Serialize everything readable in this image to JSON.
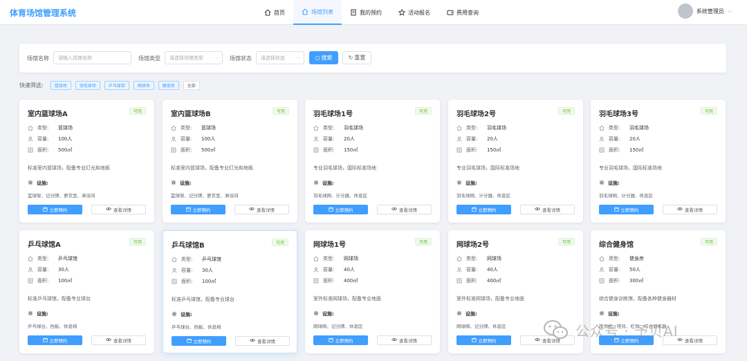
{
  "app": {
    "title": "体育场馆管理系统"
  },
  "nav": [
    {
      "label": "首页",
      "icon": "home-icon",
      "active": false
    },
    {
      "label": "场馆列表",
      "icon": "venue-icon",
      "active": true
    },
    {
      "label": "我的预约",
      "icon": "document-icon",
      "active": false
    },
    {
      "label": "活动报名",
      "icon": "star-icon",
      "active": false
    },
    {
      "label": "费用查询",
      "icon": "wallet-icon",
      "active": false
    }
  ],
  "user": {
    "name": "系统管理员"
  },
  "filter": {
    "name_label": "场馆名称",
    "name_placeholder": "请输入场馆名称",
    "type_label": "场馆类型",
    "type_placeholder": "请选择场馆类型",
    "status_label": "场馆状态",
    "status_placeholder": "请选择状态",
    "search_label": "搜索",
    "reset_label": "重置"
  },
  "quick": {
    "label": "快速筛选:",
    "tags": [
      "篮球场",
      "羽毛球场",
      "乒乓球馆",
      "网球场",
      "健身房",
      "全部"
    ]
  },
  "labels": {
    "type": "类型:",
    "capacity": "容量:",
    "area": "面积:",
    "facilities": "设施:",
    "book": "立即预约",
    "detail": "查看详情",
    "available": "可用"
  },
  "venues": [
    {
      "name": "室内篮球场A",
      "type": "篮球场",
      "capacity": "100人",
      "area": "500㎡",
      "desc": "标准室内篮球场，配备专业灯光和地板",
      "facilities": "篮球架、记分牌、更衣室、淋浴间",
      "status": "可用"
    },
    {
      "name": "室内篮球场B",
      "type": "篮球场",
      "capacity": "100人",
      "area": "500㎡",
      "desc": "标准室内篮球场，配备专业灯光和地板",
      "facilities": "篮球架、记分牌、更衣室、淋浴间",
      "status": "可用"
    },
    {
      "name": "羽毛球场1号",
      "type": "羽毛球场",
      "capacity": "20人",
      "area": "150㎡",
      "desc": "专业羽毛球场，国际标准场地",
      "facilities": "羽毛球网、计分器、休息区",
      "status": "可用"
    },
    {
      "name": "羽毛球场2号",
      "type": "羽毛球场",
      "capacity": "20人",
      "area": "150㎡",
      "desc": "专业羽毛球场，国际标准场地",
      "facilities": "羽毛球网、计分器、休息区",
      "status": "可用"
    },
    {
      "name": "羽毛球场3号",
      "type": "羽毛球场",
      "capacity": "20人",
      "area": "150㎡",
      "desc": "专业羽毛球场，国际标准场地",
      "facilities": "羽毛球网、计分器、休息区",
      "status": "可用"
    },
    {
      "name": "乒乓球馆A",
      "type": "乒乓球馆",
      "capacity": "30人",
      "area": "100㎡",
      "desc": "标准乒乓球馆，配备专业球台",
      "facilities": "乒乓球台、挡板、休息椅",
      "status": "可用"
    },
    {
      "name": "乒乓球馆B",
      "type": "乒乓球馆",
      "capacity": "30人",
      "area": "100㎡",
      "desc": "标准乒乓球馆，配备专业球台",
      "facilities": "乒乓球台、挡板、休息椅",
      "status": "可用"
    },
    {
      "name": "网球场1号",
      "type": "网球场",
      "capacity": "40人",
      "area": "400㎡",
      "desc": "室外标准网球场，配备专业地面",
      "facilities": "网球网、记分牌、休息区",
      "status": "可用"
    },
    {
      "name": "网球场2号",
      "type": "网球场",
      "capacity": "40人",
      "area": "400㎡",
      "desc": "室外标准网球场，配备专业地面",
      "facilities": "网球网、记分牌、休息区",
      "status": "可用"
    },
    {
      "name": "综合健身馆",
      "type": "健身房",
      "capacity": "50人",
      "area": "300㎡",
      "desc": "综合健身训练馆，配备各种健身器材",
      "facilities": "跑步机、哑铃、杠铃、综合训练器",
      "status": "可用"
    }
  ],
  "watermark": {
    "text": "公众号 · 予贝AI"
  },
  "colors": {
    "primary": "#409eff",
    "success": "#67c23a",
    "background": "#f0f2f5"
  }
}
